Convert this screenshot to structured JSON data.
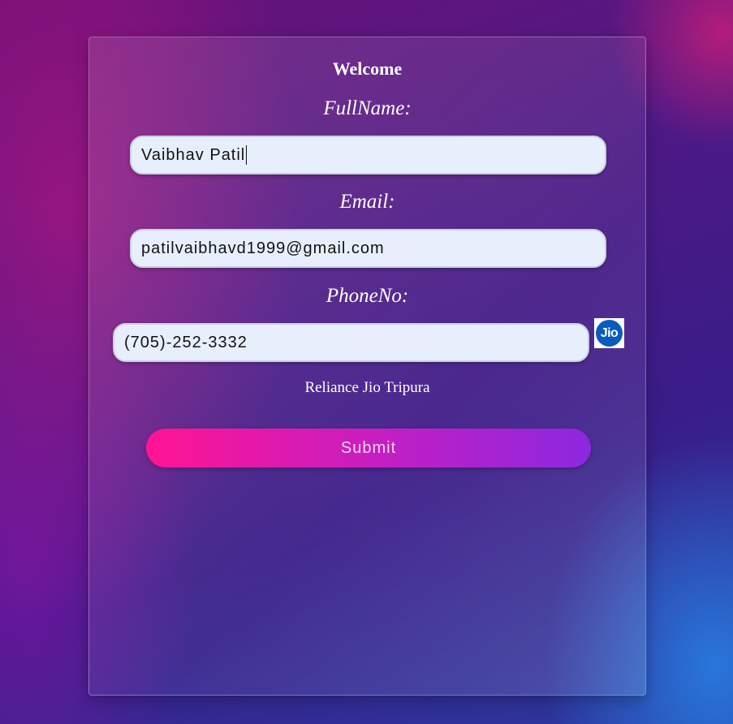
{
  "form": {
    "title": "Welcome",
    "fullname_label": "FullName:",
    "fullname_value": "Vaibhav Patil",
    "email_label": "Email:",
    "email_value": "patilvaibhavd1999@gmail.com",
    "phone_label": "PhoneNo:",
    "phone_value": "(705)-252-3332",
    "carrier_logo_text": "Jio",
    "carrier_text": "Reliance Jio Tripura",
    "submit_label": "Submit"
  },
  "colors": {
    "field_bg": "#e8effc",
    "submit_gradient_start": "#ff1493",
    "submit_gradient_end": "#8b28e0",
    "jio_blue": "#0a5bbf"
  },
  "icons": {
    "carrier_logo": "jio-logo-icon"
  }
}
